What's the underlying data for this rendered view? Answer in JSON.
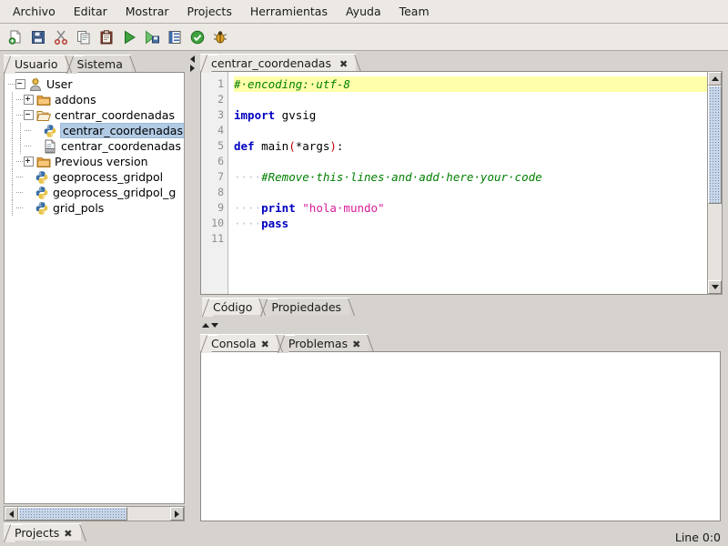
{
  "menu": {
    "items": [
      {
        "label": "Archivo"
      },
      {
        "label": "Editar"
      },
      {
        "label": "Mostrar"
      },
      {
        "label": "Projects"
      },
      {
        "label": "Herramientas"
      },
      {
        "label": "Ayuda"
      },
      {
        "label": "Team"
      }
    ]
  },
  "toolbar": {
    "buttons": [
      {
        "icon": "new-file-icon",
        "title": "Nuevo"
      },
      {
        "icon": "save-icon",
        "title": "Guardar"
      },
      {
        "icon": "cut-icon",
        "title": "Cortar"
      },
      {
        "icon": "copy-icon",
        "title": "Copiar"
      },
      {
        "icon": "paste-icon",
        "title": "Pegar"
      },
      {
        "icon": "run-icon",
        "title": "Ejecutar"
      },
      {
        "icon": "run-file-icon",
        "title": "Ejecutar archivo"
      },
      {
        "icon": "properties-list-icon",
        "title": "Propiedades"
      },
      {
        "icon": "check-ok-icon",
        "title": "Validar"
      },
      {
        "icon": "debug-bug-icon",
        "title": "Depurar"
      }
    ]
  },
  "left_panel": {
    "tabs": [
      {
        "label": "Usuario",
        "active": true
      },
      {
        "label": "Sistema",
        "active": false
      }
    ],
    "tree": [
      {
        "label": "User",
        "icon": "user-icon",
        "depth": 0,
        "expander": "minus"
      },
      {
        "label": "addons",
        "icon": "folder-icon",
        "depth": 1,
        "expander": "plus"
      },
      {
        "label": "centrar_coordenadas",
        "icon": "folder-open-icon",
        "depth": 1,
        "expander": "minus"
      },
      {
        "label": "centrar_coordenadas",
        "icon": "python-icon",
        "depth": 2,
        "expander": "none",
        "selected": true
      },
      {
        "label": "centrar_coordenadas",
        "icon": "binary-doc-icon",
        "depth": 2,
        "expander": "none"
      },
      {
        "label": "Previous version",
        "icon": "folder-icon",
        "depth": 1,
        "expander": "plus"
      },
      {
        "label": "geoprocess_gridpol",
        "icon": "python-icon",
        "depth": 1,
        "expander": "none"
      },
      {
        "label": "geoprocess_gridpol_g",
        "icon": "python-icon",
        "depth": 1,
        "expander": "none"
      },
      {
        "label": "grid_pols",
        "icon": "python-icon",
        "depth": 1,
        "expander": "none"
      }
    ],
    "bottom_tab": {
      "label": "Projects",
      "close": "✖"
    }
  },
  "editor": {
    "tab": {
      "label": "centrar_coordenadas",
      "close": "✖"
    },
    "line_numbers": [
      "1",
      "2",
      "3",
      "4",
      "5",
      "6",
      "7",
      "8",
      "9",
      "10",
      "11"
    ],
    "lines": [
      {
        "n": 1,
        "highlight": true,
        "tokens": [
          {
            "t": "# encoding: utf-8",
            "c": "cm"
          }
        ]
      },
      {
        "n": 2,
        "highlight": false,
        "tokens": []
      },
      {
        "n": 3,
        "highlight": false,
        "tokens": [
          {
            "t": "import",
            "c": "kw"
          },
          {
            "t": " gvsig",
            "c": ""
          }
        ]
      },
      {
        "n": 4,
        "highlight": false,
        "tokens": []
      },
      {
        "n": 5,
        "highlight": false,
        "tokens": [
          {
            "t": "def",
            "c": "kw"
          },
          {
            "t": " main",
            "c": ""
          },
          {
            "t": "(",
            "c": "pn"
          },
          {
            "t": "*args",
            "c": ""
          },
          {
            "t": ")",
            "c": "pn"
          },
          {
            "t": ":",
            "c": ""
          }
        ]
      },
      {
        "n": 6,
        "highlight": false,
        "tokens": []
      },
      {
        "n": 7,
        "highlight": false,
        "tokens": [
          {
            "t": "····",
            "c": "dot"
          },
          {
            "t": "#Remove this lines and add here your code",
            "c": "cm"
          }
        ]
      },
      {
        "n": 8,
        "highlight": false,
        "tokens": []
      },
      {
        "n": 9,
        "highlight": false,
        "tokens": [
          {
            "t": "····",
            "c": "dot"
          },
          {
            "t": "print",
            "c": "kw"
          },
          {
            "t": " ",
            "c": ""
          },
          {
            "t": "\"hola mundo\"",
            "c": "st"
          }
        ]
      },
      {
        "n": 10,
        "highlight": false,
        "tokens": [
          {
            "t": "····",
            "c": "dot"
          },
          {
            "t": "pass",
            "c": "kw"
          }
        ]
      },
      {
        "n": 11,
        "highlight": false,
        "tokens": []
      }
    ],
    "bottom_tabs": [
      {
        "label": "Código",
        "active": true
      },
      {
        "label": "Propiedades",
        "active": false
      }
    ]
  },
  "console": {
    "tabs": [
      {
        "label": "Consola",
        "active": true,
        "close": "✖"
      },
      {
        "label": "Problemas",
        "active": false,
        "close": "✖"
      }
    ],
    "content": ""
  },
  "statusbar": {
    "text": "Line 0:0"
  },
  "colors": {
    "chrome": "#d6d2ce",
    "tab_active": "#ece9e4",
    "selection": "#b2cbe5",
    "line_highlight": "#ffffaa",
    "keyword": "#0000c0",
    "comment": "#008000",
    "string": "#d81b9a",
    "paren": "#c00000"
  }
}
